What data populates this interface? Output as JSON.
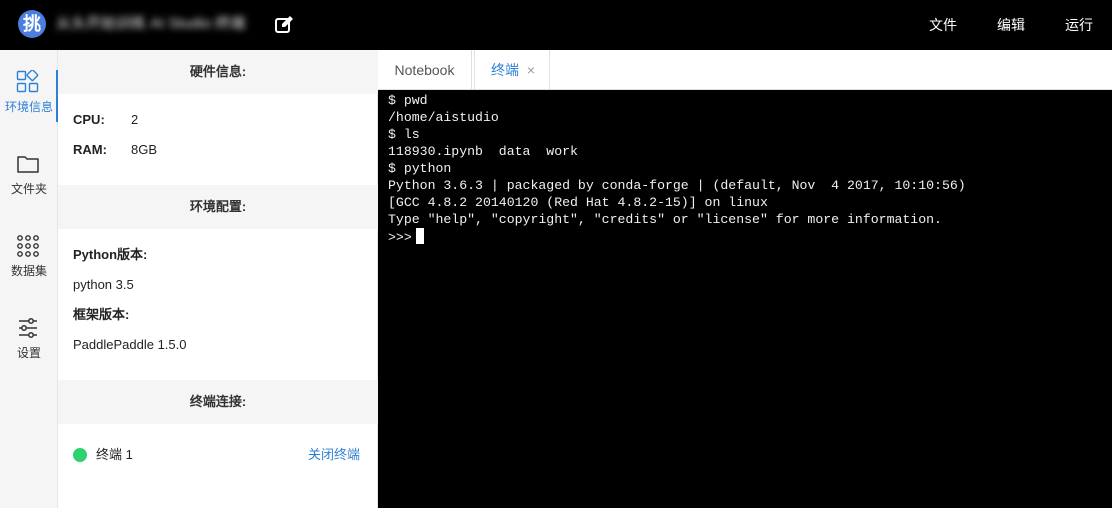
{
  "header": {
    "logo_char": "挑",
    "project_title": "从头开始训练 AI Studio 终端",
    "menu": {
      "file": "文件",
      "edit": "编辑",
      "run": "运行"
    }
  },
  "iconnav": {
    "items": [
      {
        "label": "环境信息",
        "icon": "environment-grid-icon",
        "active": true
      },
      {
        "label": "文件夹",
        "icon": "folder-icon"
      },
      {
        "label": "数据集",
        "icon": "dataset-dots-icon"
      },
      {
        "label": "设置",
        "icon": "sliders-settings-icon"
      }
    ]
  },
  "panel": {
    "hardware": {
      "title": "硬件信息:",
      "cpu_label": "CPU:",
      "cpu_value": "2",
      "ram_label": "RAM:",
      "ram_value": "8GB"
    },
    "environment": {
      "title": "环境配置:",
      "python_label": "Python版本:",
      "python_value": "python 3.5",
      "framework_label": "框架版本:",
      "framework_value": "PaddlePaddle 1.5.0"
    },
    "terminal": {
      "title": "终端连接:",
      "name": "终端 1",
      "close_label": "关闭终端",
      "status_color": "#2ed170"
    }
  },
  "tabs": [
    {
      "label": "Notebook",
      "active": false
    },
    {
      "label": "终端",
      "active": true,
      "close": "×"
    }
  ],
  "terminal": {
    "lines": [
      "$ pwd",
      "/home/aistudio",
      "$ ls",
      "118930.ipynb  data  work",
      "$ python",
      "Python 3.6.3 | packaged by conda-forge | (default, Nov  4 2017, 10:10:56)",
      "[GCC 4.8.2 20140120 (Red Hat 4.8.2-15)] on linux",
      "Type \"help\", \"copyright\", \"credits\" or \"license\" for more information.",
      ">>>"
    ]
  },
  "colors": {
    "accent": "#2e7fd6",
    "logo_bg": "#4a7fe0",
    "terminal_bg": "#000000"
  }
}
